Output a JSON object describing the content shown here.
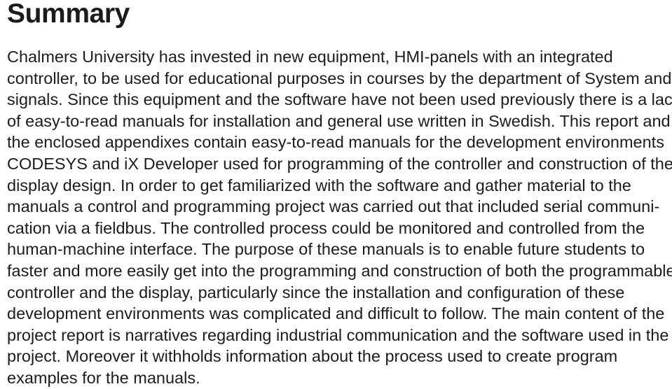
{
  "document": {
    "heading": "Summary",
    "background_color": "#ffffff",
    "text_color": "#1c1c1c",
    "alignment": "justified",
    "paragraph_full_text": "Chalmers University has invested in new equipment, HMI-panels with an integrated controller, to be used for educational purposes in courses by the department of System and signals. Since this equipment and the software have not been used previously there is a lack of easy-to-read manuals for installation and general use written in Swedish. This report and the enclosed appendixes contain easy-to-read manuals for the development environments CODESYS and iX Developer used for programming of the controller and construction of the display design. In order to get familiarized with the software and gather material to the manuals a control and programming project was carried out that included serial communication via a fieldbus. The controlled process could be monitored and controlled from the human-machine interface. The purpose of these manuals is to enable future students to faster and more easily get into the programming and construction of both the programmable controller and the display, particularly since the installation and configuration of these development environments was complicated and difficult to follow. The main content of the project report is narratives regarding industrial communication and the software used in the project. Moreover it withholds information about the process used to create program examples for the manuals.",
    "lines": [
      "Chalmers University has invested in new equipment, HMI-panels with an integrated",
      "controller, to be used for educational purposes in courses by the department of System and",
      "signals. Since this equipment and the software have not been used previously there is a lack",
      "of easy-to-read manuals for installation and general use written in Swedish. This report and",
      "the enclosed appendixes contain easy-to-read manuals for the development environments",
      "CODESYS and iX Developer used for programming of the controller and construction of the",
      "display design. In order to get familiarized with the software and gather material to the",
      "manuals a control and programming project was carried out that included serial communi-",
      "cation via a fieldbus. The controlled process could be monitored and controlled from the",
      "human-machine interface. The purpose of these manuals is to enable future students to",
      "faster and more easily get into the programming and construction of both the programmable",
      "controller and the display, particularly since the installation and configuration of these",
      "development environments was complicated and difficult to follow. The main content of the",
      "project report is narratives regarding industrial communication and the software used in the",
      "project. Moreover it withholds information about the process used to create program",
      "examples for the manuals."
    ]
  }
}
